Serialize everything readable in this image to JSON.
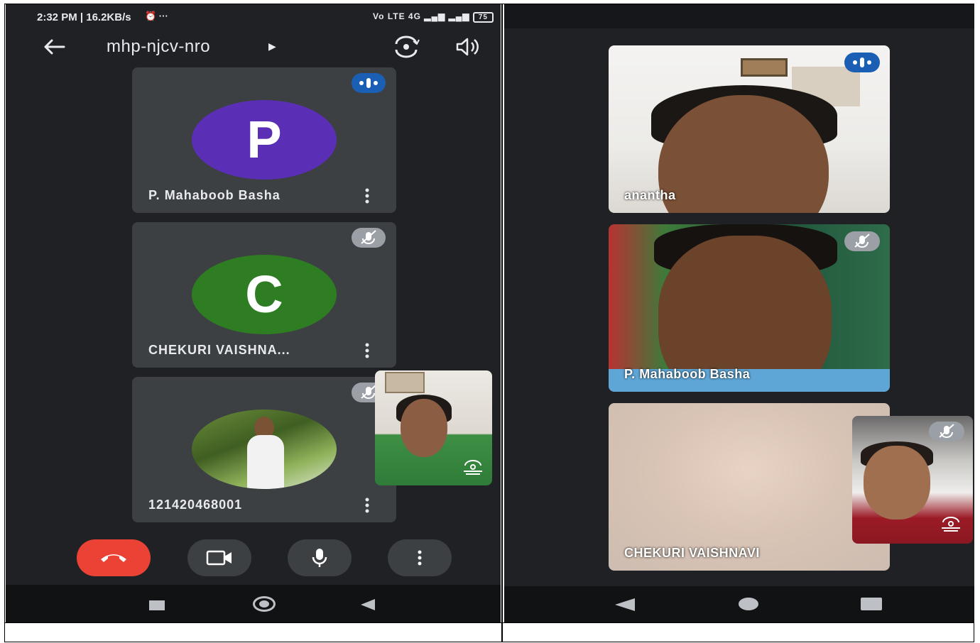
{
  "left_phone": {
    "status_bar": {
      "time": "2:32 PM | 16.2KB/s",
      "network": "Vo LTE 4G",
      "battery": "75"
    },
    "app_bar": {
      "meeting_code": "mhp-njcv-nro",
      "icons": [
        "arrow-left-icon",
        "camera-switch-icon",
        "speaker-icon"
      ]
    },
    "participants": [
      {
        "initial": "P",
        "name": "P. Mahaboob Basha",
        "avatar_color": "#5b2fb5",
        "status": "speaking"
      },
      {
        "initial": "C",
        "name": "CHEKURI VAISHNA...",
        "avatar_color": "#2e7d22",
        "status": "muted"
      },
      {
        "initial": "",
        "name": "121420468001",
        "avatar_color": "",
        "status": "muted"
      }
    ],
    "call_controls": [
      "end-call-icon",
      "video-camera-icon",
      "microphone-icon",
      "more-icon"
    ]
  },
  "right_phone": {
    "video_tiles": [
      {
        "name": "anantha",
        "status": "speaking"
      },
      {
        "name": "P. Mahaboob Basha",
        "status": "muted"
      },
      {
        "name": "CHEKURI VAISHNAVI",
        "status": "muted"
      }
    ]
  },
  "colors": {
    "background": "#202124",
    "tile": "#3c4043",
    "end_call": "#ea4335",
    "speaking_badge": "#1a5fb4"
  }
}
